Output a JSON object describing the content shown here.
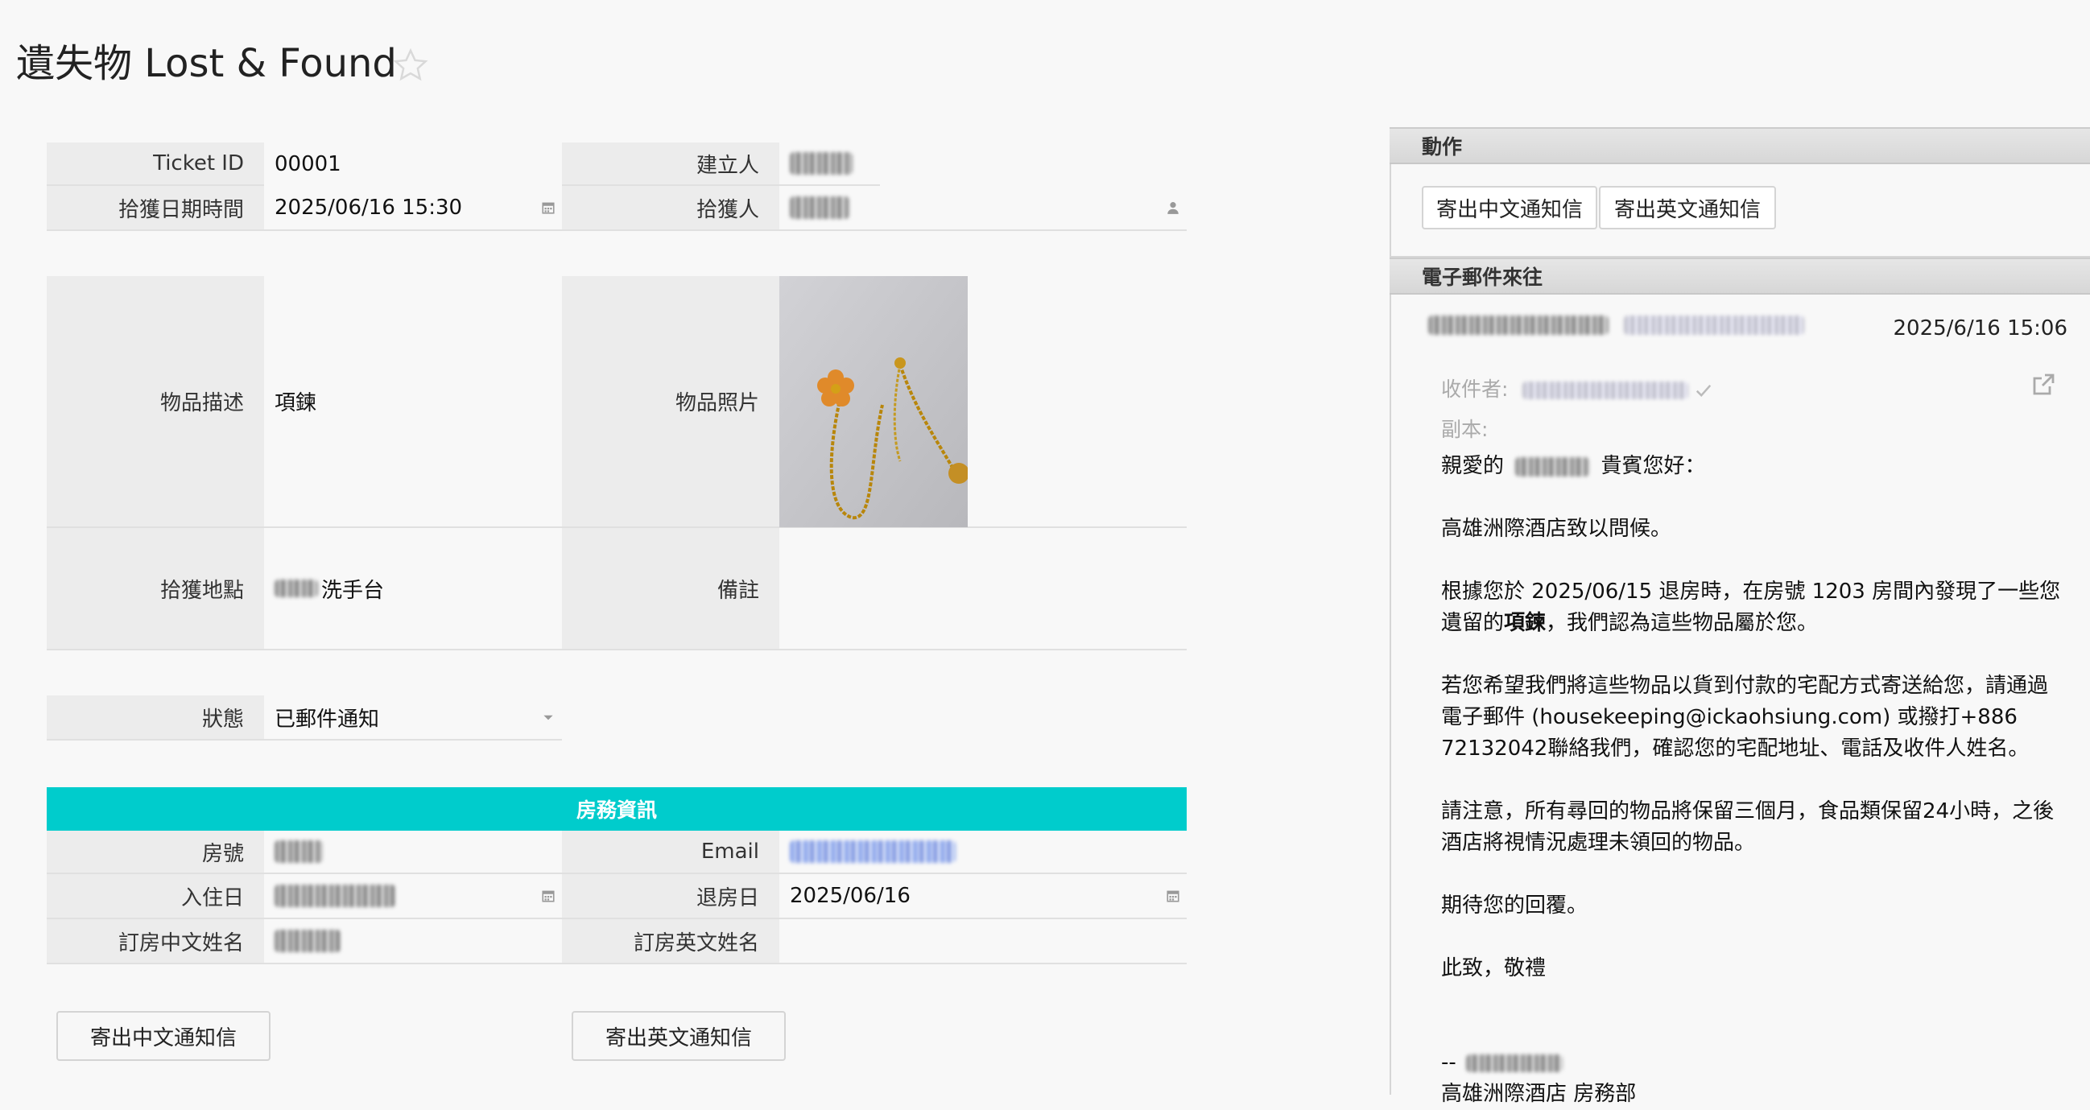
{
  "page": {
    "title": "遺失物 Lost & Found"
  },
  "form": {
    "ticket_id_label": "Ticket ID",
    "ticket_id_value": "00001",
    "creator_label": "建立人",
    "found_datetime_label": "拾獲日期時間",
    "found_datetime_value": "2025/06/16 15:30",
    "finder_label": "拾獲人",
    "item_desc_label": "物品描述",
    "item_desc_value": "項鍊",
    "item_photo_label": "物品照片",
    "found_location_label": "拾獲地點",
    "found_location_value": "洗手台",
    "notes_label": "備註",
    "notes_value": "",
    "status_label": "狀態",
    "status_value": "已郵件通知"
  },
  "room_section": {
    "title": "房務資訊",
    "room_no_label": "房號",
    "email_label": "Email",
    "checkin_label": "入住日",
    "checkout_label": "退房日",
    "checkout_value": "2025/06/16",
    "name_zh_label": "訂房中文姓名",
    "name_en_label": "訂房英文姓名",
    "name_en_value": ""
  },
  "buttons": {
    "send_zh": "寄出中文通知信",
    "send_en": "寄出英文通知信"
  },
  "actions_panel": {
    "title": "動作",
    "send_zh": "寄出中文通知信",
    "send_en": "寄出英文通知信"
  },
  "email_panel": {
    "title": "電子郵件來往",
    "date": "2025/6/16 15:06",
    "to_label": "收件者:",
    "cc_label": "副本:",
    "greeting_prefix": "親愛的",
    "greeting_suffix": "貴賓您好：",
    "line1": "高雄洲際酒店致以問候。",
    "p2_a": "根據您於 2025/06/15 退房時，在房號 1203 房間內發現了一些您遺留的",
    "p2_bold": "項鍊",
    "p2_b": "，我們認為這些物品屬於您。",
    "p3": "若您希望我們將這些物品以貨到付款的宅配方式寄送給您，請通過電子郵件 (housekeeping@ickaohsiung.com) 或撥打+886 72132042聯絡我們，確認您的宅配地址、電話及收件人姓名。",
    "p4": "請注意，所有尋回的物品將保留三個月，食品類保留24小時，之後酒店將視情況處理未領回的物品。",
    "p5": "期待您的回覆。",
    "p6": "此致，敬禮",
    "sig_prefix": "--",
    "sig_dept": "高雄洲際酒店 房務部"
  },
  "icons": {
    "star": "star-outline-icon",
    "calendar": "calendar-icon",
    "person": "person-icon",
    "dropdown": "caret-down-icon",
    "external": "external-link-icon",
    "check": "check-icon"
  },
  "colors": {
    "section_bar": "#00cccc",
    "link": "#3a6ee0"
  }
}
